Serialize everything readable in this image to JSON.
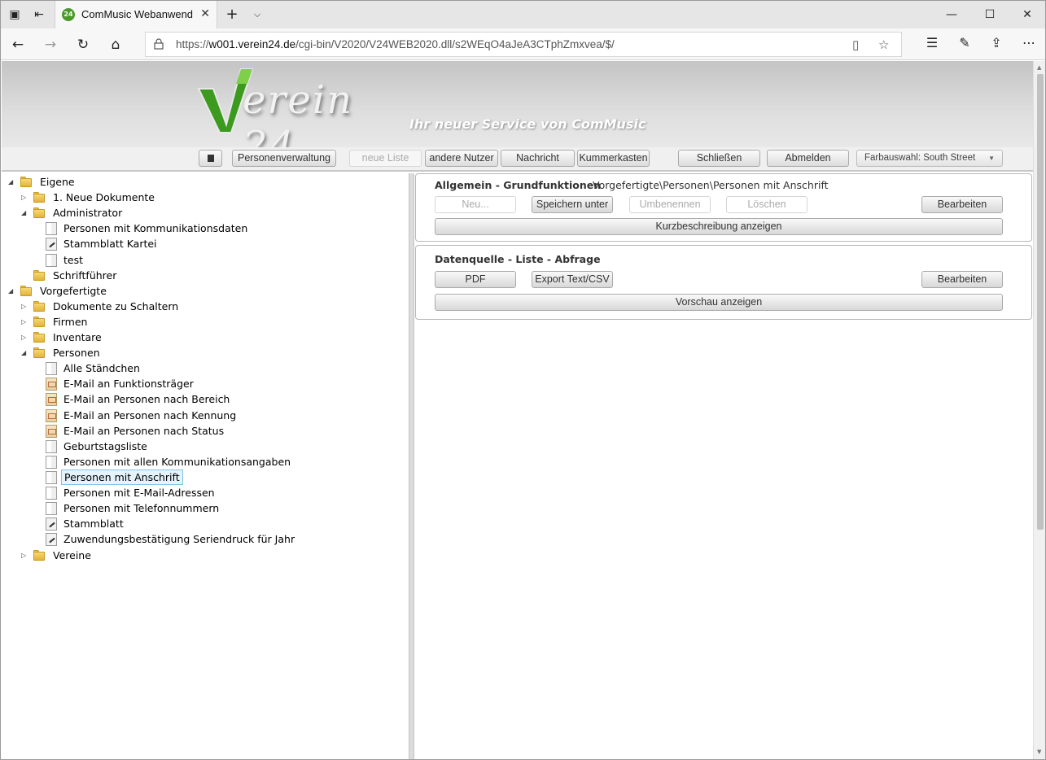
{
  "browser": {
    "tab_title": "ComMusic Webanwend",
    "tab_favicon_text": "24",
    "url_prefix": "https://",
    "url_host": "w001.verein24.de",
    "url_path": "/cgi-bin/V2020/V24WEB2020.dll/s2WEqO4aJeA3CTphZmxvea/$/"
  },
  "header": {
    "logo_text": "erein 24",
    "slogan": "Ihr neuer Service von ComMusic"
  },
  "menu": {
    "personenverwaltung": "Personenverwaltung",
    "neue_liste": "neue Liste",
    "andere_nutzer": "andere Nutzer",
    "nachricht": "Nachricht",
    "kummerkasten": "Kummerkasten",
    "schliessen": "Schließen",
    "abmelden": "Abmelden",
    "farbauswahl": "Farbauswahl: South Street"
  },
  "tree": [
    {
      "label": "Eigene",
      "type": "folder",
      "toggle": "open"
    },
    {
      "label": "1. Neue Dokumente",
      "type": "folder",
      "toggle": "closed"
    },
    {
      "label": "Administrator",
      "type": "folder",
      "toggle": "open"
    },
    {
      "label": "Personen mit Kommunikationsdaten",
      "type": "doc"
    },
    {
      "label": "Stammblatt Kartei",
      "type": "edit"
    },
    {
      "label": "test",
      "type": "doc"
    },
    {
      "label": "Schriftführer",
      "type": "folder",
      "toggle": "none"
    },
    {
      "label": "Vorgefertigte",
      "type": "folder",
      "toggle": "open"
    },
    {
      "label": "Dokumente zu Schaltern",
      "type": "folder",
      "toggle": "closed"
    },
    {
      "label": "Firmen",
      "type": "folder",
      "toggle": "closed"
    },
    {
      "label": "Inventare",
      "type": "folder",
      "toggle": "closed"
    },
    {
      "label": "Personen",
      "type": "folder",
      "toggle": "open"
    },
    {
      "label": "Alle Ständchen",
      "type": "doc"
    },
    {
      "label": "E-Mail an Funktionsträger",
      "type": "mail"
    },
    {
      "label": "E-Mail an Personen nach Bereich",
      "type": "mail"
    },
    {
      "label": "E-Mail an Personen nach Kennung",
      "type": "mail"
    },
    {
      "label": "E-Mail an Personen nach Status",
      "type": "mail"
    },
    {
      "label": "Geburtstagsliste",
      "type": "doc"
    },
    {
      "label": "Personen mit allen Kommunikationsangaben",
      "type": "doc"
    },
    {
      "label": "Personen mit Anschrift",
      "type": "doc",
      "selected": true
    },
    {
      "label": "Personen mit E-Mail-Adressen",
      "type": "doc"
    },
    {
      "label": "Personen mit Telefonnummern",
      "type": "doc"
    },
    {
      "label": "Stammblatt",
      "type": "edit"
    },
    {
      "label": "Zuwendungsbestätigung Seriendruck für Jahr",
      "type": "edit"
    },
    {
      "label": "Vereine",
      "type": "folder",
      "toggle": "closed"
    }
  ],
  "section1": {
    "title": "Allgemein - Grundfunktionen",
    "path": "Vorgefertigte\\Personen\\Personen mit Anschrift",
    "neu": "Neu...",
    "speichern_unter": "Speichern unter",
    "umbenennen": "Umbenennen",
    "loeschen": "Löschen",
    "bearbeiten": "Bearbeiten",
    "kurzbeschreibung": "Kurzbeschreibung anzeigen"
  },
  "section2": {
    "title": "Datenquelle - Liste - Abfrage",
    "pdf": "PDF",
    "export": "Export Text/CSV",
    "bearbeiten": "Bearbeiten",
    "vorschau": "Vorschau anzeigen"
  }
}
